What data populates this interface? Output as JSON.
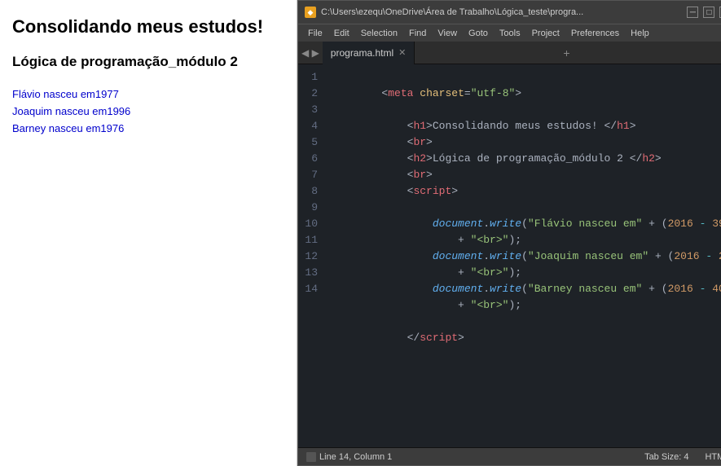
{
  "browser": {
    "h1": "Consolidando meus estudos!",
    "h2": "Lógica de programação_módulo 2",
    "outputs": [
      "Flávio nasceu em1977",
      "Joaquim nasceu em1996",
      "Barney nasceu em1976"
    ]
  },
  "editor": {
    "title_bar_text": "C:\\Users\\ezequ\\OneDrive\\Área de Trabalho\\Lógica_teste\\progra...",
    "tab_name": "programa.html",
    "menu": {
      "file": "File",
      "edit": "Edit",
      "selection": "Selection",
      "find": "Find",
      "view": "View",
      "goto": "Goto",
      "tools": "Tools",
      "project": "Project",
      "preferences": "Preferences",
      "help": "Help"
    },
    "status": {
      "position": "Line 14, Column 1",
      "tab_size": "Tab Size: 4",
      "syntax": "HTML"
    }
  }
}
